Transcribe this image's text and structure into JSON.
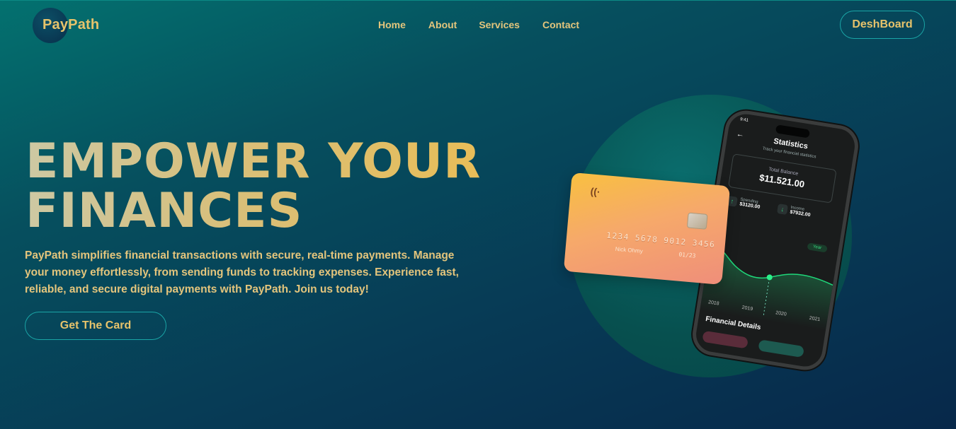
{
  "header": {
    "logo_text": "PayPath",
    "nav": [
      {
        "label": "Home"
      },
      {
        "label": "About"
      },
      {
        "label": "Services"
      },
      {
        "label": "Contact"
      }
    ],
    "dashboard_label": "DeshBoard"
  },
  "hero": {
    "title_line1": "EMPOWER YOUR",
    "title_line2": "FINANCES",
    "description": "PayPath simplifies financial transactions with secure, real-time payments. Manage your money effortlessly, from sending funds to tracking expenses. Experience fast, reliable, and secure digital payments with PayPath. Join us today!",
    "cta_label": "Get The Card"
  },
  "illustration": {
    "phone": {
      "time": "9:41",
      "title": "Statistics",
      "subtitle": "Track your financial statistics",
      "balance_label": "Total Balance",
      "balance_value": "$11.521.00",
      "spending_label": "Spending",
      "spending_value": "$3120.00",
      "income_label": "Income",
      "income_value": "$7932.00",
      "period": "Year",
      "years": [
        "2018",
        "2019",
        "2020",
        "2021"
      ],
      "section_title": "Financial Details"
    },
    "card": {
      "number": "1234 5678 9012 3456",
      "name": "Nick Ohmy",
      "expiry": "01/23"
    }
  },
  "colors": {
    "accent_gold": "#e7c36b",
    "button_border": "#1aa5a6",
    "bg_start": "#03716f",
    "bg_end": "#07284a"
  }
}
